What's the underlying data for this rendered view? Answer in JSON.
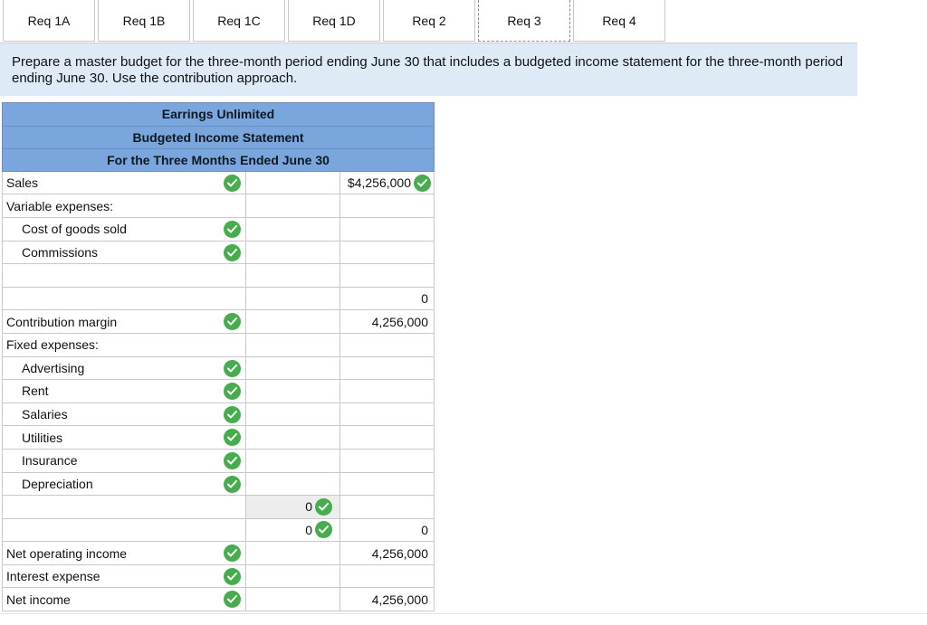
{
  "tabs": [
    {
      "label": "Req 1A"
    },
    {
      "label": "Req 1B"
    },
    {
      "label": "Req 1C"
    },
    {
      "label": "Req 1D"
    },
    {
      "label": "Req 2"
    },
    {
      "label": "Req 3"
    },
    {
      "label": "Req 4"
    }
  ],
  "active_tab": "Req 3",
  "instructions": "Prepare a master budget for the three-month period ending June 30 that includes a budgeted income statement for the three-month period ending June 30. Use the contribution approach.",
  "statement": {
    "company": "Earrings Unlimited",
    "title": "Budgeted Income Statement",
    "period": "For the Three Months Ended June 30"
  },
  "rows": {
    "sales": {
      "label": "Sales",
      "total": "$4,256,000"
    },
    "variable_expenses": {
      "label": "Variable expenses:"
    },
    "cogs": {
      "label": "Cost of goods sold"
    },
    "commissions": {
      "label": "Commissions"
    },
    "variable_total": {
      "total": "0"
    },
    "contribution_margin": {
      "label": "Contribution margin",
      "total": "4,256,000"
    },
    "fixed_expenses": {
      "label": "Fixed expenses:"
    },
    "advertising": {
      "label": "Advertising"
    },
    "rent": {
      "label": "Rent"
    },
    "salaries": {
      "label": "Salaries"
    },
    "utilities": {
      "label": "Utilities"
    },
    "insurance": {
      "label": "Insurance"
    },
    "depreciation": {
      "label": "Depreciation"
    },
    "fixed_subtotal_1": {
      "mid": "0"
    },
    "fixed_subtotal_2": {
      "mid": "0",
      "total": "0"
    },
    "net_operating_income": {
      "label": "Net operating income",
      "total": "4,256,000"
    },
    "interest_expense": {
      "label": "Interest expense"
    },
    "net_income": {
      "label": "Net income",
      "total": "4,256,000"
    }
  },
  "colors": {
    "header_blue": "#78a6dd",
    "instruction_bg": "#deebf7",
    "check_green": "#45ad4b"
  },
  "icons": {
    "correct": "check-circle-icon"
  }
}
